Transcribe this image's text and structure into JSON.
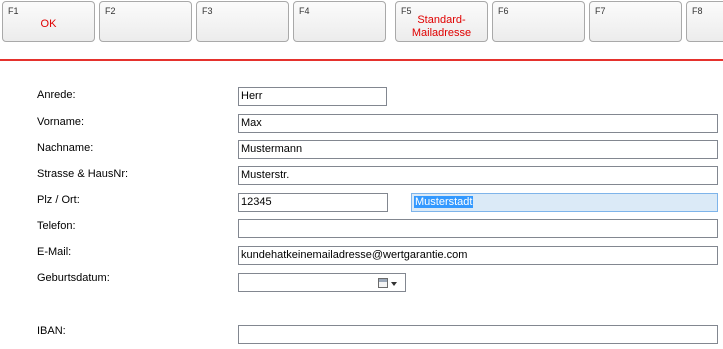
{
  "function_keys": [
    {
      "key": "F1",
      "label": "OK"
    },
    {
      "key": "F2",
      "label": ""
    },
    {
      "key": "F3",
      "label": ""
    },
    {
      "key": "F4",
      "label": ""
    },
    {
      "key": "F5",
      "label": "Standard-\nMailadresse"
    },
    {
      "key": "F6",
      "label": ""
    },
    {
      "key": "F7",
      "label": ""
    },
    {
      "key": "F8",
      "label": ""
    }
  ],
  "form": {
    "anrede": {
      "label": "Anrede:",
      "value": "Herr"
    },
    "vorname": {
      "label": "Vorname:",
      "value": "Max"
    },
    "nachname": {
      "label": "Nachname:",
      "value": "Mustermann"
    },
    "strasse": {
      "label": "Strasse & HausNr:",
      "value": "Musterstr."
    },
    "plz_ort": {
      "label": "Plz / Ort:",
      "plz_value": "12345",
      "ort_value": "Musterstadt"
    },
    "telefon": {
      "label": "Telefon:",
      "value": ""
    },
    "email": {
      "label": "E-Mail:",
      "value": "kundehatkeinemailadresse@wertgarantie.com"
    },
    "geburtsdatum": {
      "label": "Geburtsdatum:",
      "value": ""
    },
    "iban": {
      "label": "IBAN:",
      "value": ""
    }
  },
  "colors": {
    "accent_red": "#e00000",
    "separator_red": "#e5322d",
    "selection_blue": "#3399ff"
  },
  "icons": {
    "datepicker": "calendar-icon",
    "dropdown": "chevron-down-icon"
  }
}
